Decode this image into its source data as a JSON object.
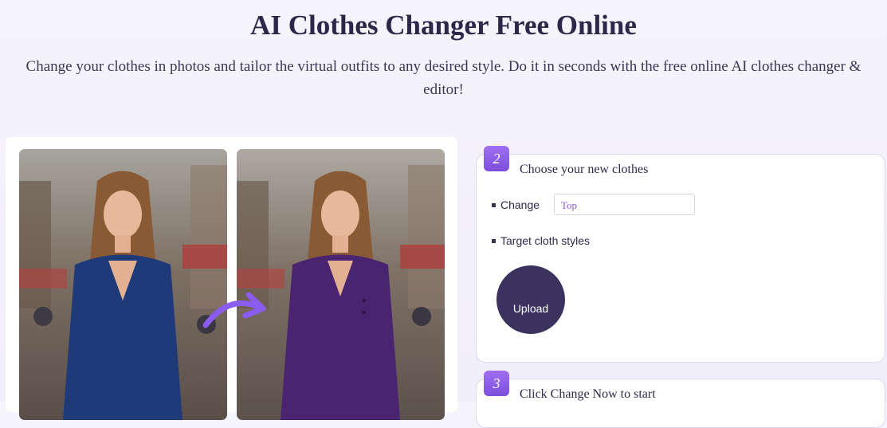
{
  "hero": {
    "title": "AI Clothes Changer Free Online",
    "subtitle": "Change your clothes in photos and tailor the virtual outfits to any desired style. Do it in seconds with the free online AI clothes changer & editor!"
  },
  "preview": {
    "before_dress_color": "#1f3a78",
    "after_dress_color": "#4a2470",
    "arrow_color": "#8a5cf0"
  },
  "step2": {
    "number": "2",
    "title": "Choose your new clothes",
    "change_label": "Change",
    "change_value": "Top",
    "target_label": "Target cloth styles",
    "upload_label": "Upload"
  },
  "step3": {
    "number": "3",
    "title": "Click Change Now to start"
  },
  "colors": {
    "accent": "#8a5cf0",
    "upload_button": "#3b3260",
    "title_text": "#2c2849"
  }
}
